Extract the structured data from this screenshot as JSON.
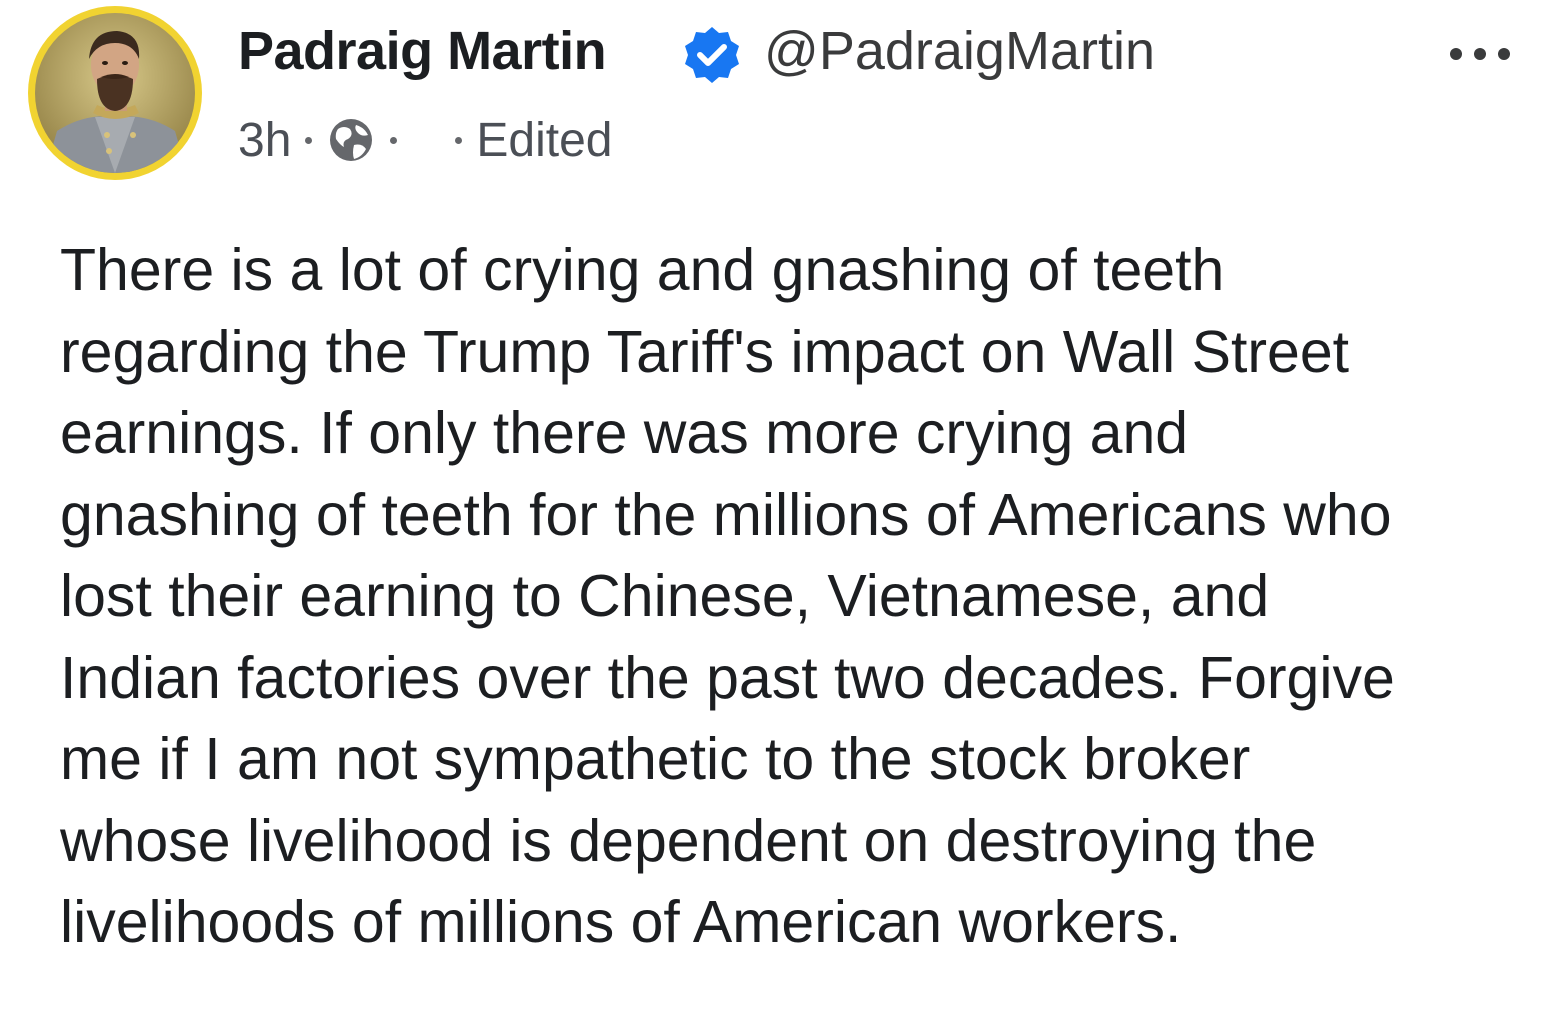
{
  "post": {
    "author": {
      "name": "Padraig Martin",
      "handle": "@PadraigMartin",
      "verified": true
    },
    "meta": {
      "time": "3h",
      "audience_icon": "globe-icon",
      "edited": "Edited"
    },
    "menu_icon": "more-options-icon",
    "body_lines": [
      "There is a lot of crying and gnashing of teeth",
      "regarding the Trump Tariff's impact on Wall Street",
      "earnings. If only there was more crying and",
      "gnashing of teeth for the millions of Americans who",
      "lost their earning to Chinese, Vietnamese, and",
      "Indian factories over the past two decades. Forgive",
      "me if I am not sympathetic to the stock broker",
      "whose livelihood is dependent on destroying the",
      "livelihoods of millions of American workers."
    ]
  },
  "colors": {
    "avatar_ring": "#f1d331",
    "verified_badge": "#1877f2",
    "text": "#1c1e21",
    "secondary_text": "#4b4f56"
  }
}
